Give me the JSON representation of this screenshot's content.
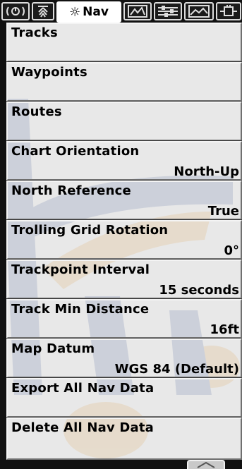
{
  "tabs": [
    {
      "name": "sonar-tab",
      "icon": "sonar-icon"
    },
    {
      "name": "navigation-tab",
      "icon": "navigation-icon"
    },
    {
      "name": "nav-tab",
      "icon": "nav-sun-icon",
      "label": "Nav",
      "active": true
    },
    {
      "name": "chart-tab",
      "icon": "chart-icon"
    },
    {
      "name": "setup-tab",
      "icon": "sliders-icon"
    },
    {
      "name": "views-tab",
      "icon": "views-icon"
    },
    {
      "name": "accessories-tab",
      "icon": "accessories-icon"
    }
  ],
  "active_tab": {
    "label": "Nav"
  },
  "menu": {
    "items": [
      {
        "label": "Tracks",
        "value": ""
      },
      {
        "label": "Waypoints",
        "value": ""
      },
      {
        "label": "Routes",
        "value": ""
      },
      {
        "label": "Chart Orientation",
        "value": "North-Up"
      },
      {
        "label": "North Reference",
        "value": "True"
      },
      {
        "label": "Trolling Grid Rotation",
        "value": "0°"
      },
      {
        "label": "Trackpoint Interval",
        "value": "15 seconds"
      },
      {
        "label": "Track Min Distance",
        "value": "16ft"
      },
      {
        "label": "Map Datum",
        "value": "WGS 84 (Default)"
      },
      {
        "label": "Export All Nav Data",
        "value": ""
      },
      {
        "label": "Delete All Nav Data",
        "value": ""
      }
    ]
  },
  "scroll": {
    "icon": "scroll-up-icon"
  },
  "colors": {
    "menu_bg": "#cdcdcd",
    "frame": "#111111",
    "watermark_blue": "#1f3f8f",
    "watermark_orange": "#f29a1f"
  }
}
